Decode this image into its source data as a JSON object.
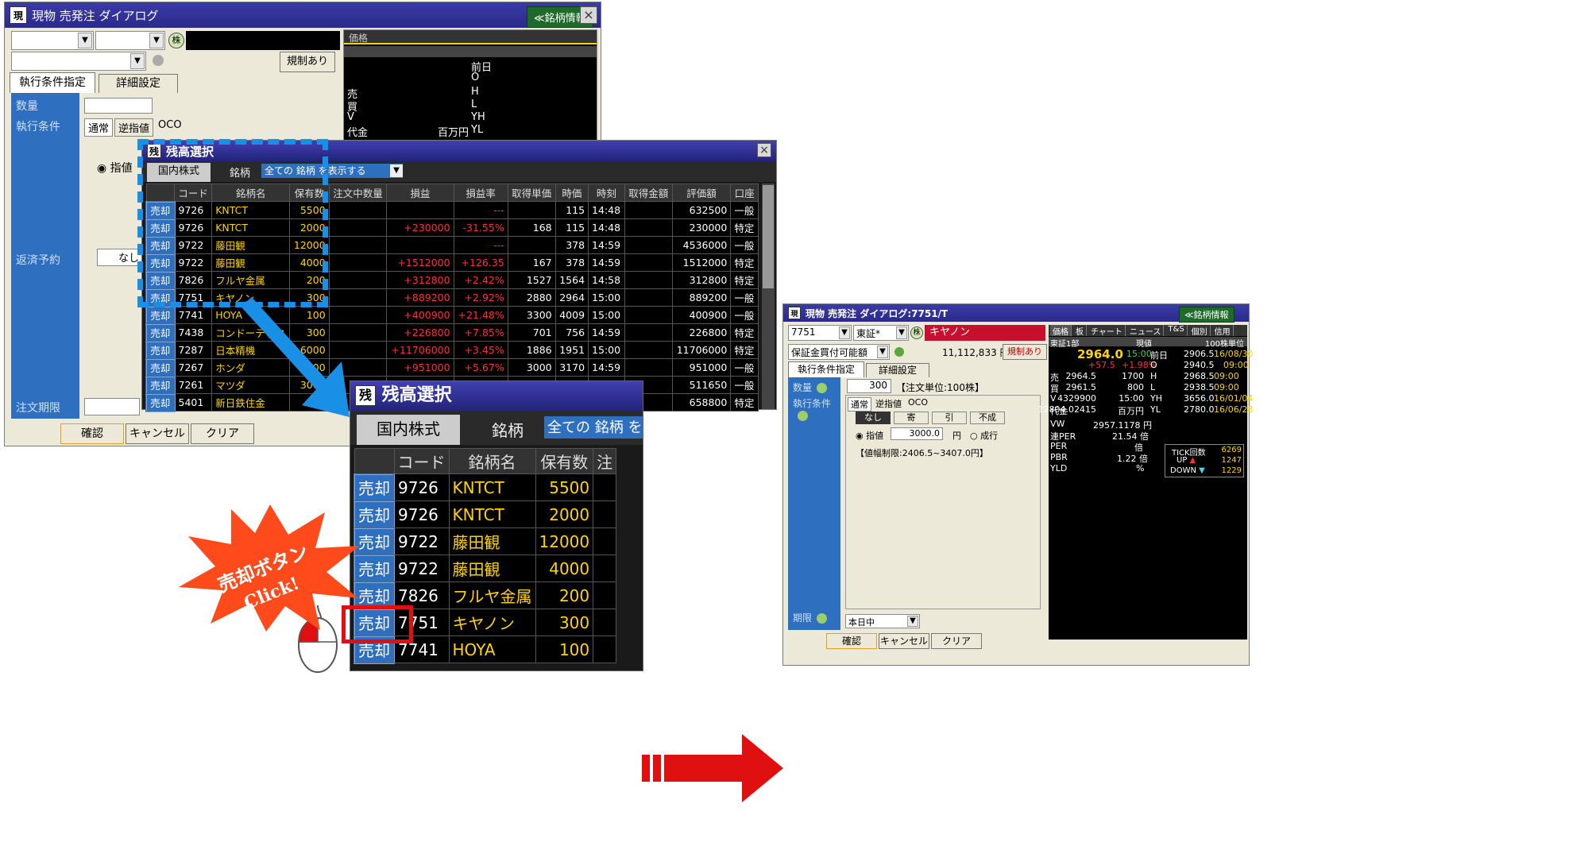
{
  "back_window": {
    "title": "現物 売発注 ダイアログ",
    "brand_button": "≪銘柄情報",
    "close": "×",
    "regulation_button": "規制あり",
    "tabs": [
      "執行条件指定",
      "詳細設定"
    ],
    "side_labels": [
      "数量",
      "執行条件",
      "返済予約",
      "注文期限"
    ],
    "cond_tabs": [
      "通常",
      "逆指値",
      "OCO"
    ],
    "limit_radio": "指値",
    "none_label": "なし",
    "footer": [
      "確認",
      "キャンセル",
      "クリア"
    ],
    "price_tab": "価格",
    "price_labels": {
      "prev": "前日",
      "o": "O",
      "h": "H",
      "l": "L",
      "yh": "YH",
      "yl": "YL",
      "sell": "売",
      "buy": "買",
      "v": "V",
      "amount": "代金",
      "unit": "百万円"
    }
  },
  "balance_window": {
    "title": "残高選択",
    "close": "×",
    "tab": "国内株式",
    "brand_label": "銘柄",
    "brand_select": "全ての 銘柄 を表示する",
    "headers": [
      "",
      "コード",
      "銘柄名",
      "保有数",
      "注文中数量",
      "損益",
      "損益率",
      "取得単価",
      "時価",
      "時刻",
      "取得金額",
      "評価額",
      "口座"
    ],
    "sell_label": "売却",
    "rows": [
      {
        "code": "9726",
        "name": "KNTCT",
        "qty": "5500",
        "pl": "",
        "rate": "---",
        "cost": "",
        "price": "115",
        "time": "14:48",
        "amount": "",
        "value": "632500",
        "acct": "一般"
      },
      {
        "code": "9726",
        "name": "KNTCT",
        "qty": "2000",
        "pl": "+230000",
        "rate": "-31.55%",
        "cost": "168",
        "price": "115",
        "time": "14:48",
        "amount": "",
        "value": "230000",
        "acct": "特定"
      },
      {
        "code": "9722",
        "name": "藤田観",
        "qty": "12000",
        "pl": "",
        "rate": "---",
        "cost": "",
        "price": "378",
        "time": "14:59",
        "amount": "",
        "value": "4536000",
        "acct": "一般"
      },
      {
        "code": "9722",
        "name": "藤田観",
        "qty": "4000",
        "pl": "+1512000",
        "rate": "+126.35",
        "cost": "167",
        "price": "378",
        "time": "14:59",
        "amount": "",
        "value": "1512000",
        "acct": "特定"
      },
      {
        "code": "7826",
        "name": "フルヤ金属",
        "qty": "200",
        "pl": "+312800",
        "rate": "+2.42%",
        "cost": "1527",
        "price": "1564",
        "time": "14:58",
        "amount": "",
        "value": "312800",
        "acct": "特定"
      },
      {
        "code": "7751",
        "name": "キヤノン",
        "qty": "300",
        "pl": "+889200",
        "rate": "+2.92%",
        "cost": "2880",
        "price": "2964",
        "time": "15:00",
        "amount": "",
        "value": "889200",
        "acct": "一般"
      },
      {
        "code": "7741",
        "name": "HOYA",
        "qty": "100",
        "pl": "+400900",
        "rate": "+21.48%",
        "cost": "3300",
        "price": "4009",
        "time": "15:00",
        "amount": "",
        "value": "400900",
        "acct": "一般"
      },
      {
        "code": "7438",
        "name": "コンドーテック",
        "qty": "300",
        "pl": "+226800",
        "rate": "+7.85%",
        "cost": "701",
        "price": "756",
        "time": "14:59",
        "amount": "",
        "value": "226800",
        "acct": "特定"
      },
      {
        "code": "7287",
        "name": "日本精機",
        "qty": "6000",
        "pl": "+11706000",
        "rate": "+3.45%",
        "cost": "1886",
        "price": "1951",
        "time": "15:00",
        "amount": "",
        "value": "11706000",
        "acct": "特定"
      },
      {
        "code": "7267",
        "name": "ホンダ",
        "qty": "300",
        "pl": "+951000",
        "rate": "+5.67%",
        "cost": "3000",
        "price": "3170",
        "time": "14:59",
        "amount": "",
        "value": "951000",
        "acct": "一般"
      },
      {
        "code": "7261",
        "name": "マツダ",
        "qty": "3000",
        "pl": "",
        "rate": "",
        "cost": "",
        "price": "",
        "time": "",
        "amount": "",
        "value": "511650",
        "acct": "一般"
      },
      {
        "code": "5401",
        "name": "新日鉄住金",
        "qty": "",
        "pl": "",
        "rate": "",
        "cost": "",
        "price": "",
        "time": "",
        "amount": "",
        "value": "658800",
        "acct": "特定"
      }
    ]
  },
  "zoom": {
    "title": "残高選択",
    "tab": "国内株式",
    "brand_label": "銘柄",
    "brand_select": "全ての 銘柄 を",
    "headers": [
      "",
      "コード",
      "銘柄名",
      "保有数",
      "注"
    ],
    "rows": [
      {
        "code": "9726",
        "name": "KNTCT",
        "qty": "5500"
      },
      {
        "code": "9726",
        "name": "KNTCT",
        "qty": "2000"
      },
      {
        "code": "9722",
        "name": "藤田観",
        "qty": "12000"
      },
      {
        "code": "9722",
        "name": "藤田観",
        "qty": "4000"
      },
      {
        "code": "7826",
        "name": "フルヤ金属",
        "qty": "200"
      },
      {
        "code": "7751",
        "name": "キヤノン",
        "qty": "300"
      },
      {
        "code": "7741",
        "name": "HOYA",
        "qty": "100"
      }
    ]
  },
  "callout": {
    "line1": "売却ボタン",
    "line2": "Click!"
  },
  "result_window": {
    "title": "現物 売発注 ダイアログ:7751/T",
    "brand_button": "≪銘柄情報",
    "code": "7751",
    "market": "東証*",
    "name": "キヤノン",
    "account": "保証金買付可能額",
    "amount": "11,112,833",
    "yen": "円",
    "regulation": "規制あり",
    "tabs": [
      "執行条件指定",
      "詳細設定"
    ],
    "side_labels": [
      "数量",
      "執行条件",
      "期限"
    ],
    "qty": "300",
    "unit_note": "【注文単位:100株】",
    "cond_tabs": [
      "通常",
      "逆指値",
      "OCO"
    ],
    "exec_buttons": [
      "なし",
      "寄",
      "引",
      "不成"
    ],
    "limit_label": "指値",
    "limit_price": "3000.0",
    "market_label": "成行",
    "price_range": "【値幅制限:2406.5~3407.0円】",
    "expiry": "本日中",
    "footer": [
      "確認",
      "キャンセル",
      "クリア"
    ],
    "price_tabs": [
      "価格",
      "板",
      "チャート",
      "ニュース",
      "T&S",
      "個別",
      "信用"
    ],
    "market_name": "東証1部",
    "board_unit": "100株単位",
    "current_label": "現値",
    "current_price": "2964.0",
    "current_time": "15:00",
    "prev_label": "前日",
    "change": "+57.5",
    "change_rate": "+1.98%",
    "quote_rows": [
      {
        "l": "売",
        "v": "2964.5",
        "q": "1700",
        "k": "H",
        "p": "2968.5",
        "t": "09:00"
      },
      {
        "l": "買",
        "v": "2961.5",
        "q": "800",
        "k": "L",
        "p": "2938.5",
        "t": "09:00"
      },
      {
        "l": "V",
        "v": "4329900",
        "q": "15:00",
        "k": "YH",
        "p": "3656.0",
        "t": "16/01/04"
      },
      {
        "l": "代金",
        "v": "12804.02415",
        "q": "百万円",
        "k": "YL",
        "p": "2780.0",
        "t": "16/06/28"
      }
    ],
    "prev_price": "2906.5",
    "prev_date": "16/08/30",
    "o_price": "2940.5",
    "o_time": "09:00",
    "vw": "2957.1178",
    "vw_unit": "円",
    "per_label": "連PER",
    "per": "21.54",
    "bai": "倍",
    "per2_label": "PER",
    "pbr_label": "PBR",
    "pbr": "1.22",
    "yld_label": "YLD",
    "pct": "%",
    "tick_label": "TICK回数",
    "tick": "6269",
    "up_label": "UP",
    "up": "1247",
    "down_label": "DOWN",
    "down": "1229"
  }
}
